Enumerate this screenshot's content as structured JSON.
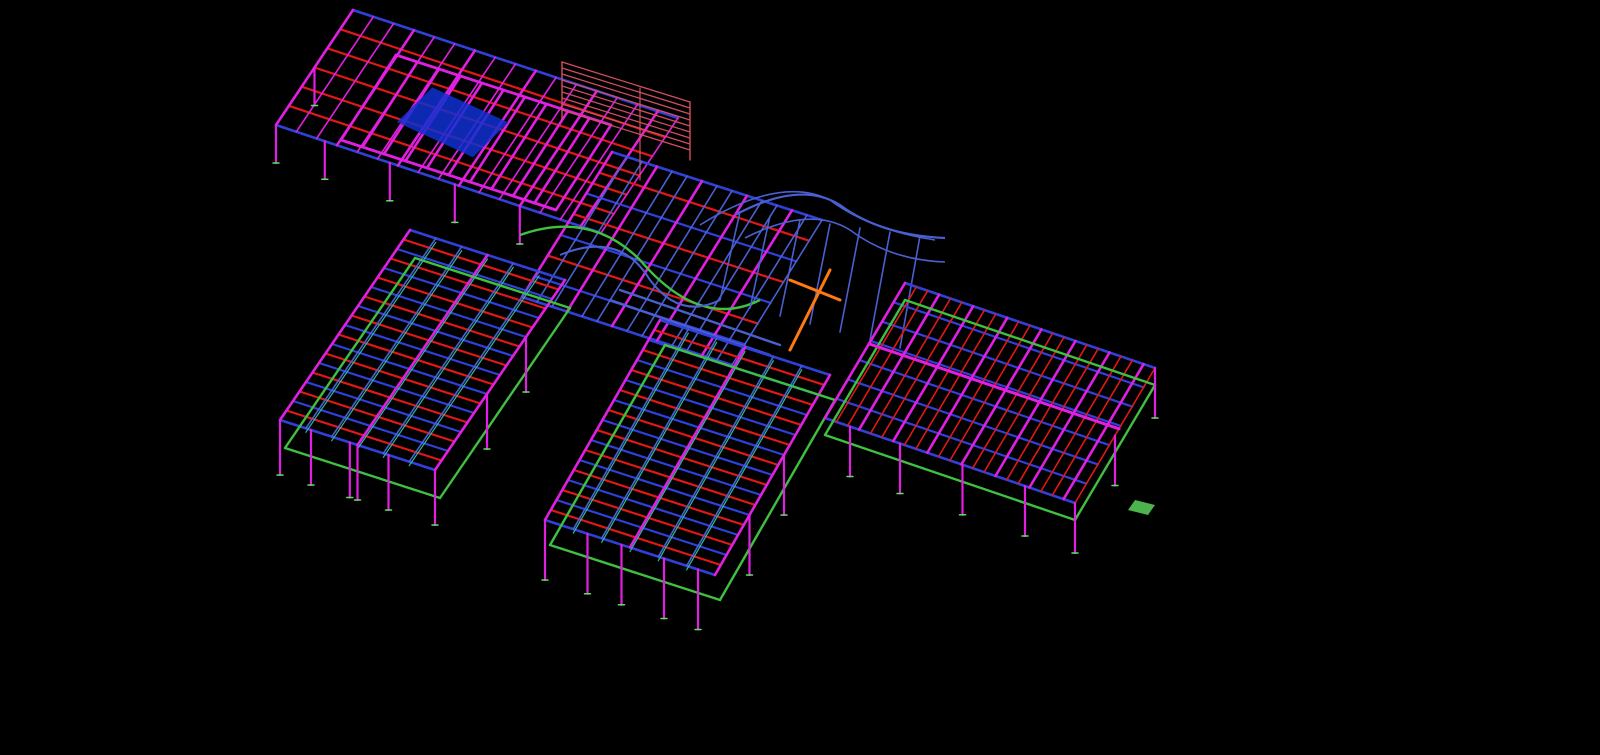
{
  "view": {
    "background": "#000000",
    "projection": "isometric"
  },
  "member_colors": {
    "column": "#e020e0",
    "primary_beam": "#e020e0",
    "girder": "#3040d8",
    "secondary_beam": "#e01818",
    "edge_beam": "#40c040",
    "bracing": "#30b8a0",
    "roof_truss": "#4a60d0",
    "stair": "#d05060",
    "highlight": "#ff7a10",
    "deck_panel": "#1030d0",
    "footing": "#60e060"
  },
  "components": [
    {
      "name": "roof-block",
      "icon": "roof-frame-icon"
    },
    {
      "name": "west-wing",
      "icon": "floor-frame-icon"
    },
    {
      "name": "center-wing",
      "icon": "floor-frame-icon"
    },
    {
      "name": "east-wing",
      "icon": "floor-frame-icon"
    },
    {
      "name": "curved-canopy",
      "icon": "canopy-icon"
    },
    {
      "name": "stair-tower",
      "icon": "stair-icon"
    }
  ]
}
